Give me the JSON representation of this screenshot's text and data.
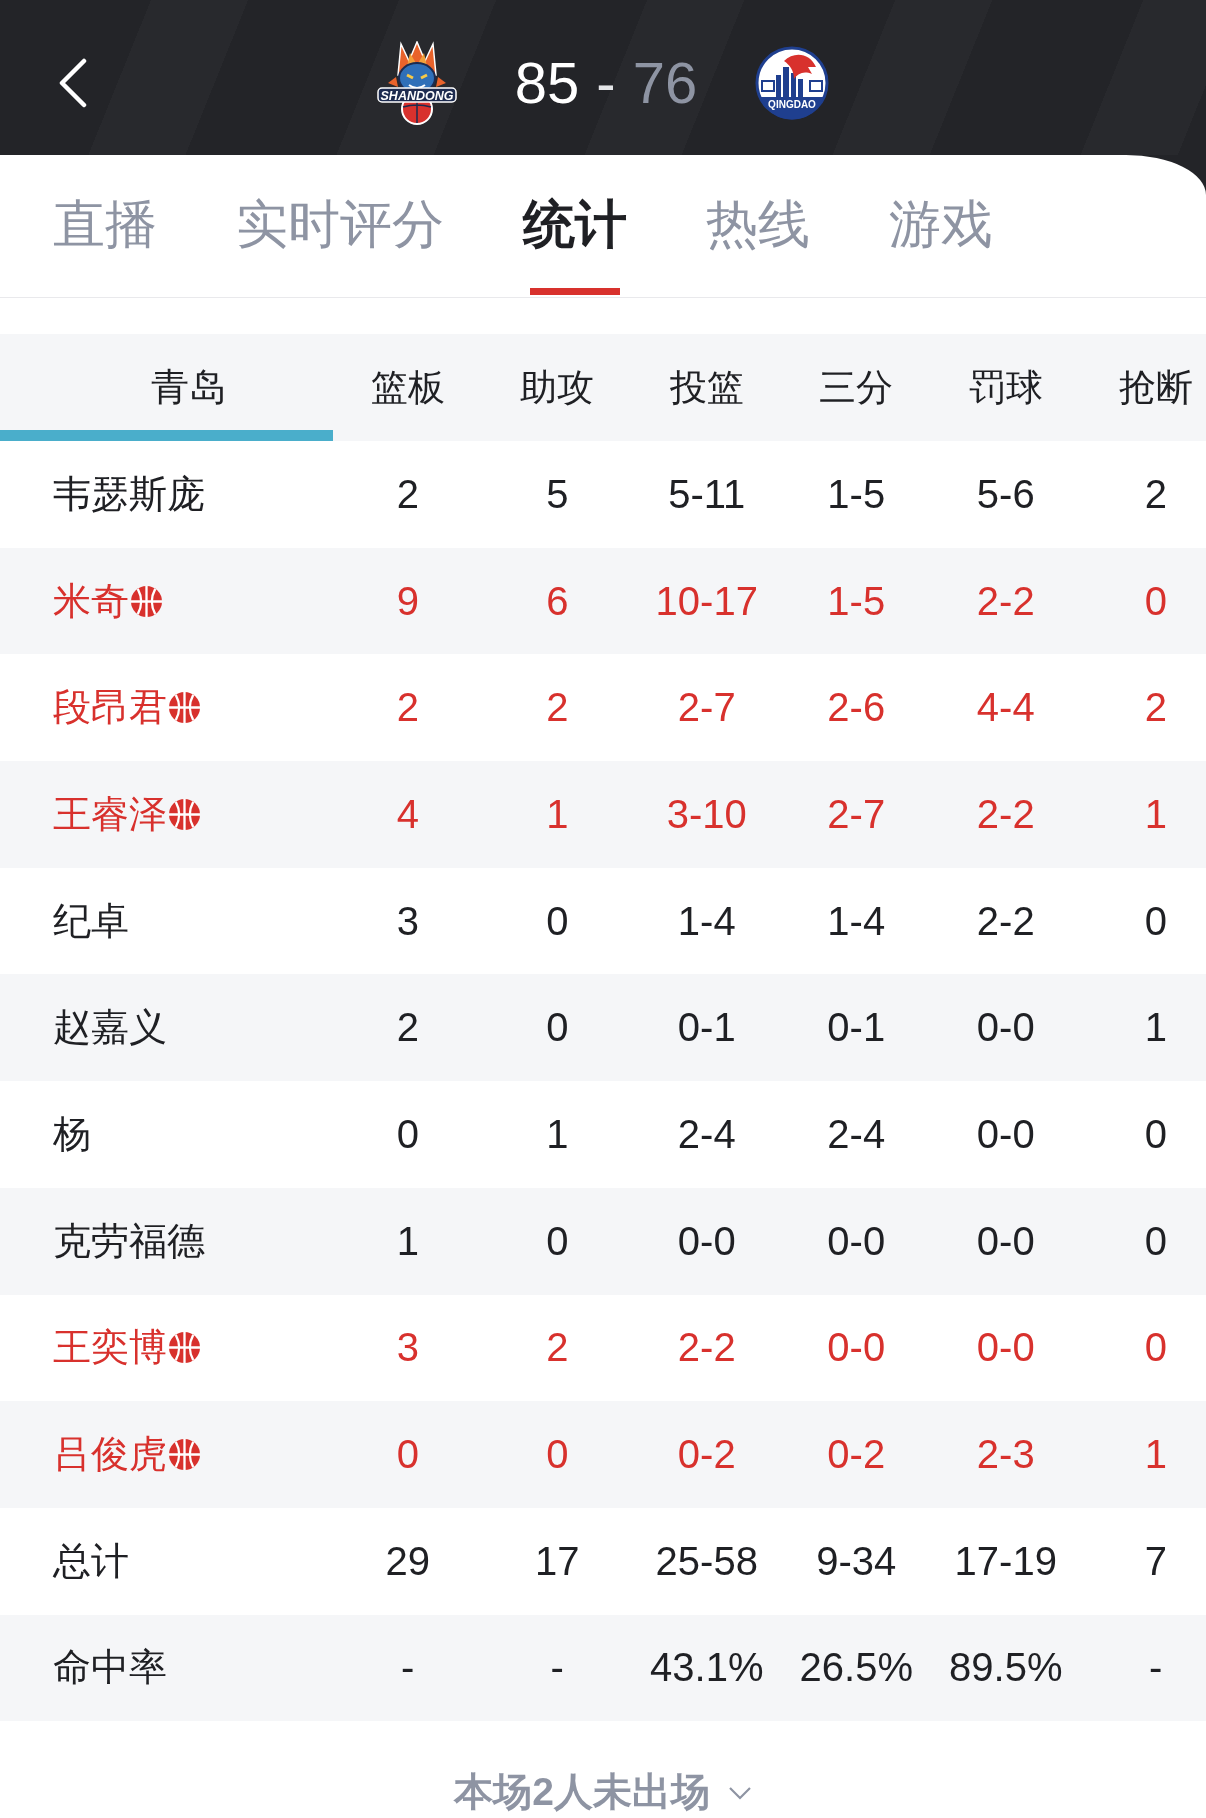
{
  "scoreboard": {
    "teams": [
      {
        "kind": "dragon",
        "logo_text": "SHANDONG",
        "score": "85",
        "leading": true
      },
      {
        "kind": "eagle",
        "logo_text": "QINGDAO",
        "score": "76",
        "leading": false
      }
    ],
    "separator": "-"
  },
  "tabs": [
    {
      "label": "直播",
      "selected": false
    },
    {
      "label": "实时评分",
      "selected": false
    },
    {
      "label": "统计",
      "selected": true
    },
    {
      "label": "热线",
      "selected": false
    },
    {
      "label": "游戏",
      "selected": false
    }
  ],
  "table": {
    "team": {
      "label": "青岛",
      "selected": true
    },
    "columns": [
      "篮板",
      "助攻",
      "投篮",
      "三分",
      "罚球",
      "抢断"
    ],
    "rows": [
      {
        "name": "韦瑟斯庞",
        "starter": false,
        "stats": [
          "2",
          "5",
          "5-11",
          "1-5",
          "5-6",
          "2"
        ]
      },
      {
        "name": "米奇",
        "starter": true,
        "stats": [
          "9",
          "6",
          "10-17",
          "1-5",
          "2-2",
          "0"
        ]
      },
      {
        "name": "段昂君",
        "starter": true,
        "stats": [
          "2",
          "2",
          "2-7",
          "2-6",
          "4-4",
          "2"
        ]
      },
      {
        "name": "王睿泽",
        "starter": true,
        "stats": [
          "4",
          "1",
          "3-10",
          "2-7",
          "2-2",
          "1"
        ]
      },
      {
        "name": "纪卓",
        "starter": false,
        "stats": [
          "3",
          "0",
          "1-4",
          "1-4",
          "2-2",
          "0"
        ]
      },
      {
        "name": "赵嘉义",
        "starter": false,
        "stats": [
          "2",
          "0",
          "0-1",
          "0-1",
          "0-0",
          "1"
        ]
      },
      {
        "name": "杨",
        "starter": false,
        "stats": [
          "0",
          "1",
          "2-4",
          "2-4",
          "0-0",
          "0"
        ]
      },
      {
        "name": "克劳福德",
        "starter": false,
        "stats": [
          "1",
          "0",
          "0-0",
          "0-0",
          "0-0",
          "0"
        ]
      },
      {
        "name": "王奕博",
        "starter": true,
        "stats": [
          "3",
          "2",
          "2-2",
          "0-0",
          "0-0",
          "0"
        ]
      },
      {
        "name": "吕俊虎",
        "starter": true,
        "stats": [
          "0",
          "0",
          "0-2",
          "0-2",
          "2-3",
          "1"
        ]
      }
    ],
    "summary": [
      {
        "label": "总计",
        "stats": [
          "29",
          "17",
          "25-58",
          "9-34",
          "17-19",
          "7"
        ]
      },
      {
        "label": "命中率",
        "stats": [
          "-",
          "-",
          "43.1%",
          "26.5%",
          "89.5%",
          "-"
        ]
      }
    ]
  },
  "footer": {
    "label": "本场2人未出场"
  }
}
